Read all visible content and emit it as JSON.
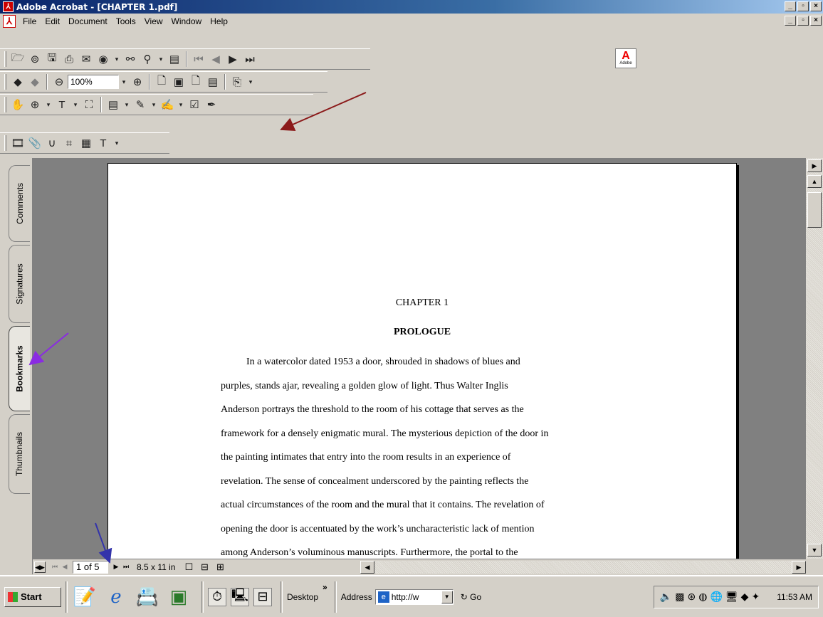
{
  "window": {
    "title": "Adobe Acrobat - [CHAPTER 1.pdf]",
    "min": "_",
    "max": "▫",
    "close": "×"
  },
  "menu": {
    "items": [
      "File",
      "Edit",
      "Document",
      "Tools",
      "View",
      "Window",
      "Help"
    ]
  },
  "toolbar": {
    "zoom_value": "100%",
    "adobe_logo_text": "Adobe"
  },
  "side_tabs": [
    "Comments",
    "Signatures",
    "Bookmarks",
    "Thumbnails"
  ],
  "active_tab": "Bookmarks",
  "document": {
    "chapter": "CHAPTER 1",
    "heading": "PROLOGUE",
    "lines": [
      "In a watercolor dated 1953 a door, shrouded in shadows of blues and",
      "purples, stands ajar, revealing a golden glow of light.  Thus Walter Inglis",
      "Anderson portrays the threshold to the room of his cottage that serves as the",
      "framework for a densely enigmatic mural. The mysterious depiction of the door in",
      "the painting intimates that entry into the room results in an experience of",
      "revelation.  The sense of concealment underscored by the painting reflects the",
      "actual circumstances of the room and the mural that it contains.  The revelation of",
      "opening the door is accentuated by the work’s uncharacteristic lack of mention",
      "among Anderson’s voluminous manuscripts.  Furthermore, the portal to the"
    ]
  },
  "status": {
    "page_indicator": "1 of 5",
    "page_size": "8.5 x 11 in"
  },
  "taskbar": {
    "start_label": "Start",
    "desktop_label": "Desktop",
    "address_label": "Address",
    "address_value": "http://w",
    "go_label": "Go",
    "clock": "11:53 AM"
  },
  "colors": {
    "arrow_red": "#8b1a1a",
    "arrow_purple": "#8a2be2",
    "arrow_blue": "#3333aa"
  }
}
